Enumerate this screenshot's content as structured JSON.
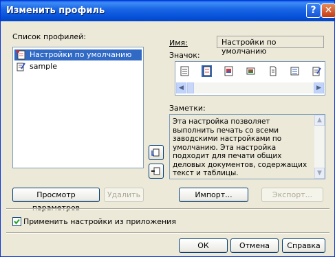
{
  "window": {
    "title": "Изменить профиль"
  },
  "titlebar": {
    "help_glyph": "?",
    "close_glyph": "✕"
  },
  "profiles": {
    "label": "Список профилей:",
    "items": [
      {
        "label": "Настройки по умолчанию",
        "selected": true,
        "icon": "document-pin-icon"
      },
      {
        "label": "sample",
        "selected": false,
        "icon": "pencil-document-icon"
      }
    ]
  },
  "name": {
    "label": "Имя:",
    "value": "Настройки по умолчанию"
  },
  "icon_picker": {
    "label": "Значок:",
    "icons": [
      "text-document-icon",
      "document-selected-icon",
      "graphics-document-icon",
      "landscape-image-icon",
      "portrait-document-icon",
      "wide-document-icon",
      "pencil-document-icon"
    ]
  },
  "notes": {
    "label": "Заметки:",
    "text": "Эта настройка позволяет выполнить печать со всеми заводскими настройками по умолчанию. Эта настройка подходит для печати общих деловых документов, содержащих текст и таблицы."
  },
  "buttons": {
    "view_settings": "Просмотр параметров",
    "delete": "Удалить",
    "import": "Импорт...",
    "export": "Экспорт...",
    "ok": "ОК",
    "cancel": "Отмена",
    "help": "Справка"
  },
  "apply_from_app": {
    "label": "Применить настройки из приложения",
    "checked": true
  },
  "colors": {
    "title_bar": "#0a5ee8",
    "selection": "#316ac5",
    "dialog_bg": "#ece9d8"
  }
}
